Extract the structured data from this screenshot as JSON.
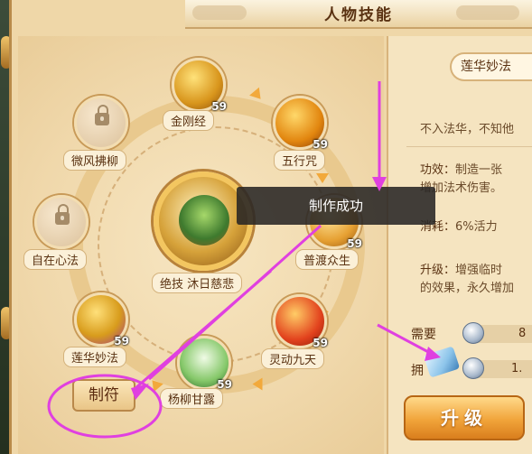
{
  "window": {
    "title": "人物技能"
  },
  "skills": [
    {
      "name": "金刚经",
      "level": "59",
      "locked": false
    },
    {
      "name": "五行咒",
      "level": "59",
      "locked": false
    },
    {
      "name": "普渡众生",
      "level": "59",
      "locked": false
    },
    {
      "name": "灵动九天",
      "level": "59",
      "locked": false
    },
    {
      "name": "杨柳甘露",
      "level": "59",
      "locked": false
    },
    {
      "name": "莲华妙法",
      "level": "59",
      "locked": false
    },
    {
      "name": "自在心法",
      "level": "",
      "locked": true
    },
    {
      "name": "微风拂柳",
      "level": "",
      "locked": true
    }
  ],
  "center_skill": {
    "name": "绝技 沐日慈悲"
  },
  "toast": {
    "text": "制作成功"
  },
  "make_button": {
    "label": "制符"
  },
  "detail": {
    "skill_name": "莲华妙法",
    "intro": "不入法华，不知他",
    "effect_label": "功效：",
    "effect_line1": "制造一张",
    "effect_line2": "增加法术伤害。",
    "consume_label": "消耗：",
    "consume_value": "6%活力",
    "upgrade_label": "升级：",
    "upgrade_line1": "增强临时",
    "upgrade_line2": "的效果，永久增加"
  },
  "cost": {
    "need_label": "需要",
    "have_label": "拥",
    "need_value": "8",
    "have_value": "1."
  },
  "upgrade_button": {
    "label": "升级"
  },
  "colors": {
    "annotation": "#e040e0",
    "panel": "#efd7a8",
    "accent": "#f1a43a"
  }
}
